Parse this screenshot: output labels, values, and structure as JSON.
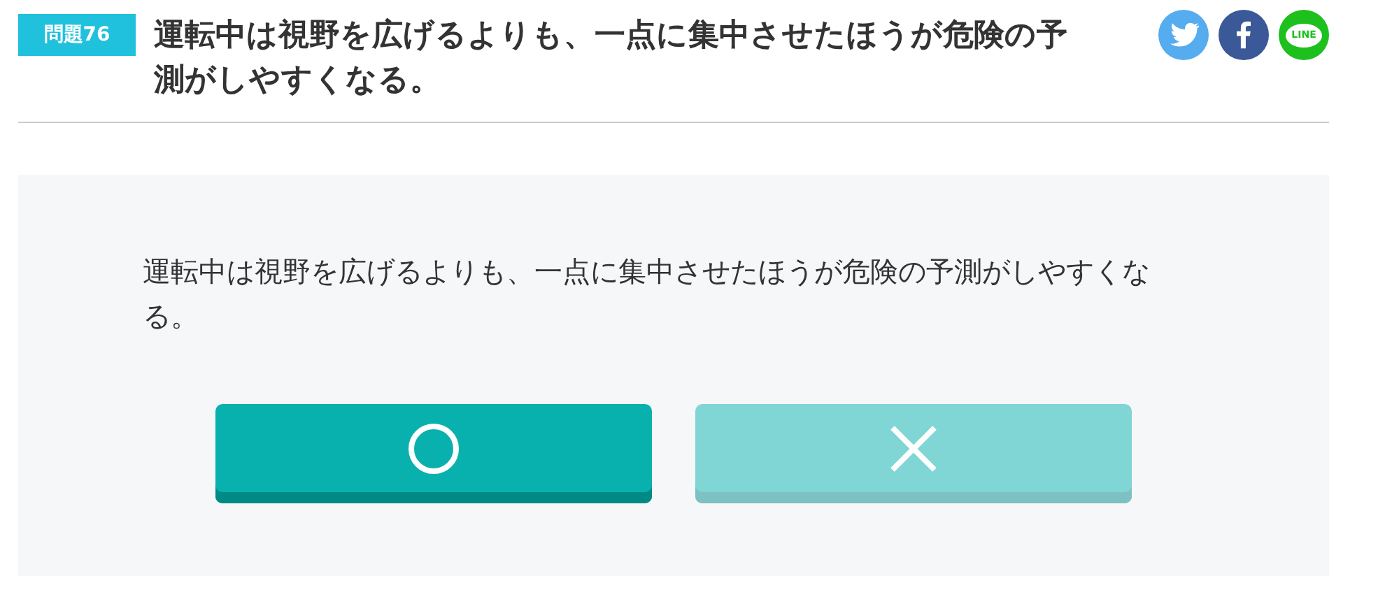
{
  "question": {
    "badge": "問題76",
    "title": "運転中は視野を広げるよりも、一点に集中させたほうが危険の予測がしやすくなる。"
  },
  "share": [
    {
      "kind": "twitter"
    },
    {
      "kind": "facebook"
    },
    {
      "kind": "line",
      "label": "LINE"
    }
  ],
  "panel": {
    "text": "運転中は視野を広げるよりも、一点に集中させたほうが危険の予測がしやすくなる。",
    "answers": [
      {
        "kind": "circle",
        "dimmed": false
      },
      {
        "kind": "cross",
        "dimmed": true
      }
    ]
  }
}
